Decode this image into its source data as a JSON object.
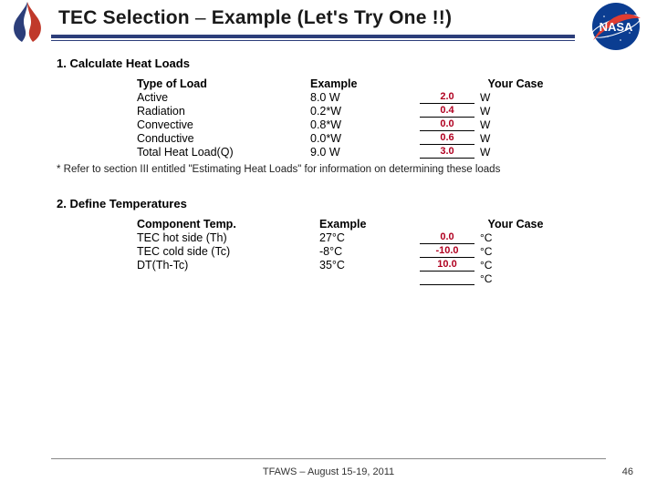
{
  "header": {
    "title_a": "TEC Selection ",
    "title_dash": "–",
    "title_b": " Example (Let's Try One !!)"
  },
  "section1": {
    "title": "1.  Calculate Heat Loads",
    "hdr": {
      "c1": "Type of Load",
      "c2": "Example",
      "c3": "Your Case"
    },
    "rows": [
      {
        "label": "Active",
        "example": "8.0 W",
        "val": "2.0",
        "unit": "W"
      },
      {
        "label": "Radiation",
        "example": "0.2*W",
        "val": "0.4",
        "unit": "W"
      },
      {
        "label": "Convective",
        "example": "0.8*W",
        "val": "0.0",
        "unit": "W"
      },
      {
        "label": "Conductive",
        "example": "0.0*W",
        "val": "0.6",
        "unit": "W"
      },
      {
        "label": "Total Heat Load(Q)",
        "example": "9.0 W",
        "val": "3.0",
        "unit": "W"
      }
    ],
    "note": "* Refer to section III entitled \"Estimating Heat Loads\" for information on determining these loads"
  },
  "section2": {
    "title": "2.  Define Temperatures",
    "hdr": {
      "c1": "Component Temp.",
      "c2": "Example",
      "c3": "Your Case"
    },
    "rows": [
      {
        "label": "TEC hot side (Th)",
        "example": "27°C",
        "val": "0.0",
        "unit": "°C"
      },
      {
        "label": "TEC cold side (Tc)",
        "example": "-8°C",
        "val": "-10.0",
        "unit": "°C"
      },
      {
        "label": "DT(Th-Tc)",
        "example": "35°C",
        "val": "10.0",
        "unit": "°C"
      },
      {
        "label": "",
        "example": "",
        "val": "",
        "unit": "°C"
      }
    ]
  },
  "footer": {
    "text": "TFAWS – August 15-19, 2011",
    "page": "46"
  }
}
